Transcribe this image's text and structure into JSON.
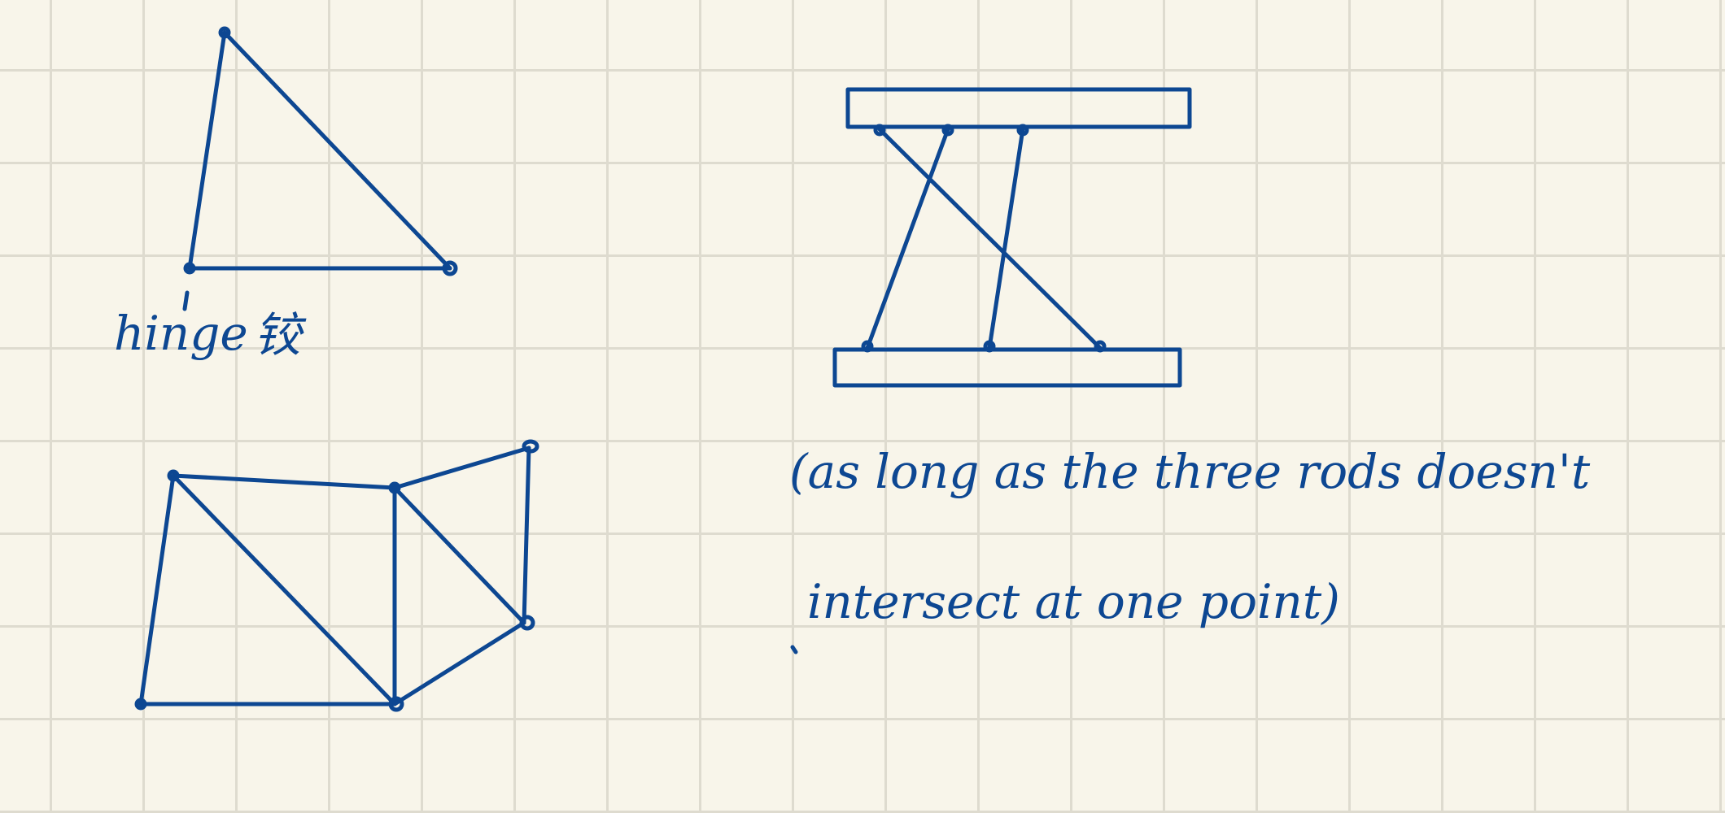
{
  "ink_color": "#0d4792",
  "grid_color": "#dedbcf",
  "paper_color": "#f8f5ea",
  "labels": {
    "hinge": "hinge",
    "hinge_cjk": "铰",
    "note_line1": "(as long as the three rods doesn't",
    "note_line2": "intersect at one point)"
  }
}
